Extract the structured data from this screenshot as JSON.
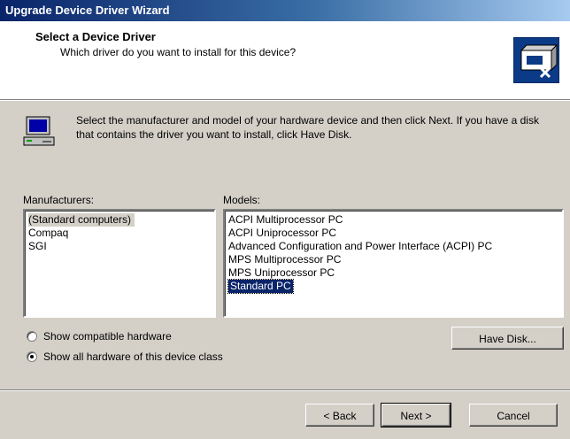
{
  "window": {
    "title": "Upgrade Device Driver Wizard"
  },
  "header": {
    "title": "Select a Device Driver",
    "subtitle": "Which driver do you want to install for this device?",
    "icon": "hardware-wizard-icon"
  },
  "intro": {
    "icon": "computer-icon",
    "text": "Select the manufacturer and model of your hardware device and then click Next. If you have a disk that contains the driver you want to install, click Have Disk."
  },
  "manufacturers": {
    "label": "Manufacturers:",
    "items": [
      "(Standard computers)",
      "Compaq",
      "SGI"
    ],
    "selected": "(Standard computers)"
  },
  "models": {
    "label": "Models:",
    "items": [
      "ACPI Multiprocessor PC",
      "ACPI Uniprocessor PC",
      "Advanced Configuration and Power Interface (ACPI) PC",
      "MPS Multiprocessor PC",
      "MPS Uniprocessor PC",
      "Standard PC"
    ],
    "selected": "Standard PC"
  },
  "options": {
    "compatible_label": "Show compatible hardware",
    "all_label": "Show all hardware of this device class",
    "selected": "all"
  },
  "buttons": {
    "have_disk": "Have Disk...",
    "back": "< Back",
    "next": "Next >",
    "cancel": "Cancel"
  }
}
